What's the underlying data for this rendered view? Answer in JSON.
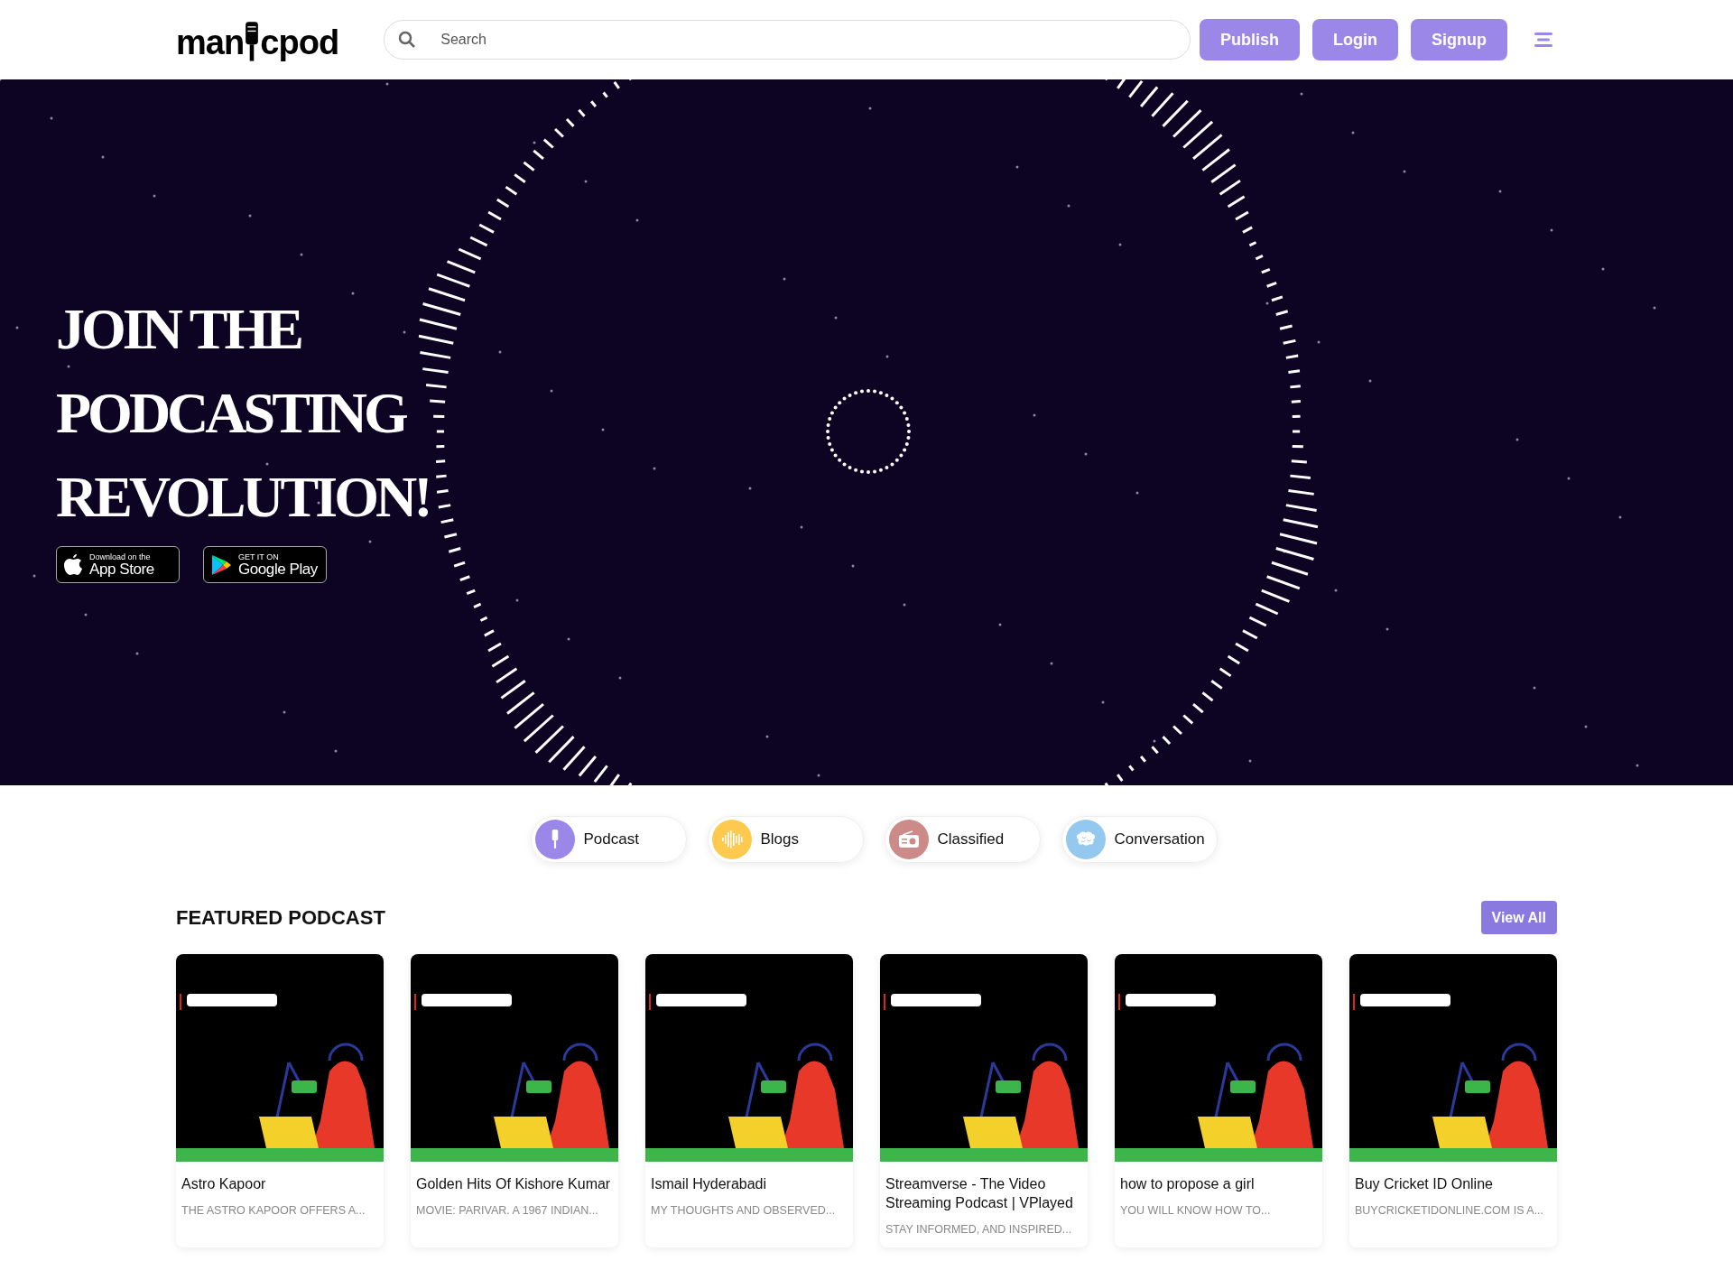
{
  "header": {
    "logo": {
      "before": "man",
      "after": "cpod"
    },
    "search": {
      "placeholder": "Search"
    },
    "buttons": [
      "Publish",
      "Login",
      "Signup"
    ]
  },
  "hero": {
    "headline": [
      "JOIN THE",
      "PODCASTING",
      "REVOLUTION!"
    ],
    "badges": [
      {
        "kind": "apple",
        "small": "Download on the",
        "big": "App Store"
      },
      {
        "kind": "google",
        "small": "GET IT ON",
        "big": "Google Play"
      }
    ]
  },
  "categories": [
    {
      "kind": "mic",
      "label": "Podcast",
      "color": "#9a87e8"
    },
    {
      "kind": "wave",
      "label": "Blogs",
      "color": "#fdc94f"
    },
    {
      "kind": "radio",
      "label": "Classified",
      "color": "#cc8a88"
    },
    {
      "kind": "brain",
      "label": "Conversation",
      "color": "#95c8ee"
    }
  ],
  "featured": {
    "title": "FEATURED PODCAST",
    "view_all": "View All",
    "cards": [
      {
        "title": "Astro Kapoor",
        "description": "THE ASTRO KAPOOR OFFERS A..."
      },
      {
        "title": "Golden Hits Of Kishore Kumar",
        "description": "MOVIE: PARIVAR. A 1967 INDIAN..."
      },
      {
        "title": "Ismail Hyderabadi",
        "description": "MY THOUGHTS AND OBSERVED..."
      },
      {
        "title": "Streamverse - The Video Streaming Podcast | VPlayed",
        "description": "STAY INFORMED, AND INSPIRED..."
      },
      {
        "title": "how to propose a girl",
        "description": "YOU WILL KNOW HOW TO..."
      },
      {
        "title": "Buy Cricket ID Online",
        "description": "BUYCRICKETIDONLINE.COM IS A..."
      }
    ]
  }
}
